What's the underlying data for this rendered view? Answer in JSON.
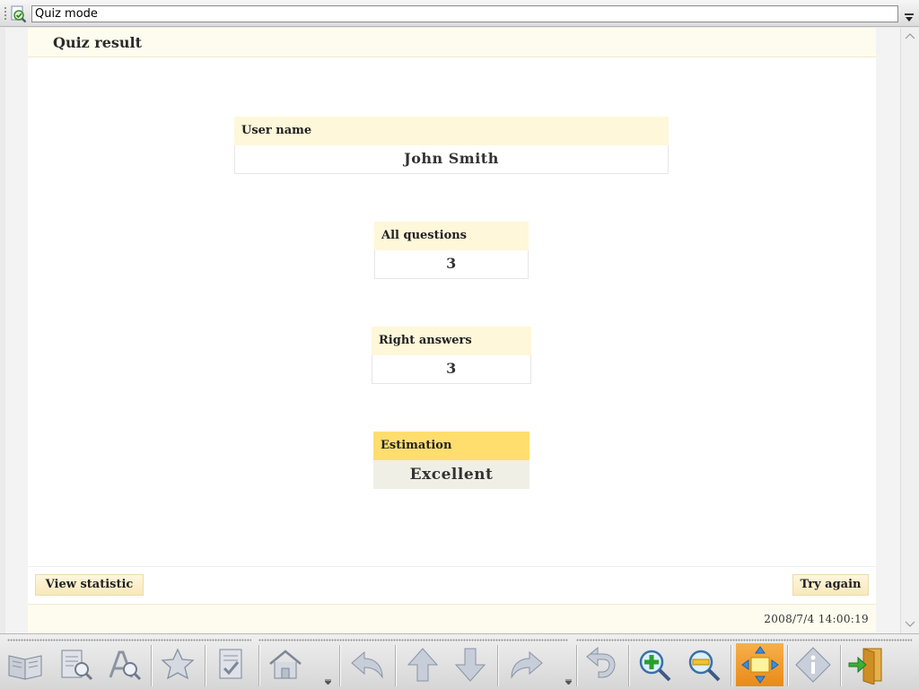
{
  "window": {
    "title": "Quiz mode"
  },
  "page": {
    "title": "Quiz result"
  },
  "results": {
    "user_name": {
      "label": "User name",
      "value": "John Smith"
    },
    "all_questions": {
      "label": "All questions",
      "value": "3"
    },
    "right_answers": {
      "label": "Right answers",
      "value": "3"
    },
    "estimation": {
      "label": "Estimation",
      "value": "Excellent"
    }
  },
  "actions": {
    "view_statistic": "View statistic",
    "try_again": "Try again"
  },
  "status": {
    "timestamp": "2008/7/4 14:00:19"
  },
  "toolbar": {
    "icons": [
      "book-icon",
      "document-search-icon",
      "text-search-icon",
      "star-icon",
      "quiz-check-icon",
      "home-icon",
      "undo-arrow-icon",
      "arrow-up-icon",
      "arrow-down-icon",
      "redo-arrow-icon",
      "rotate-back-icon",
      "zoom-in-icon",
      "zoom-out-icon",
      "fit-page-icon",
      "info-icon",
      "exit-door-icon"
    ]
  },
  "colors": {
    "header_bg": "#fefcee",
    "label_bg": "#fef7d9",
    "estimation_bg": "#ffde6e",
    "active_tool": "#f2a13a"
  }
}
